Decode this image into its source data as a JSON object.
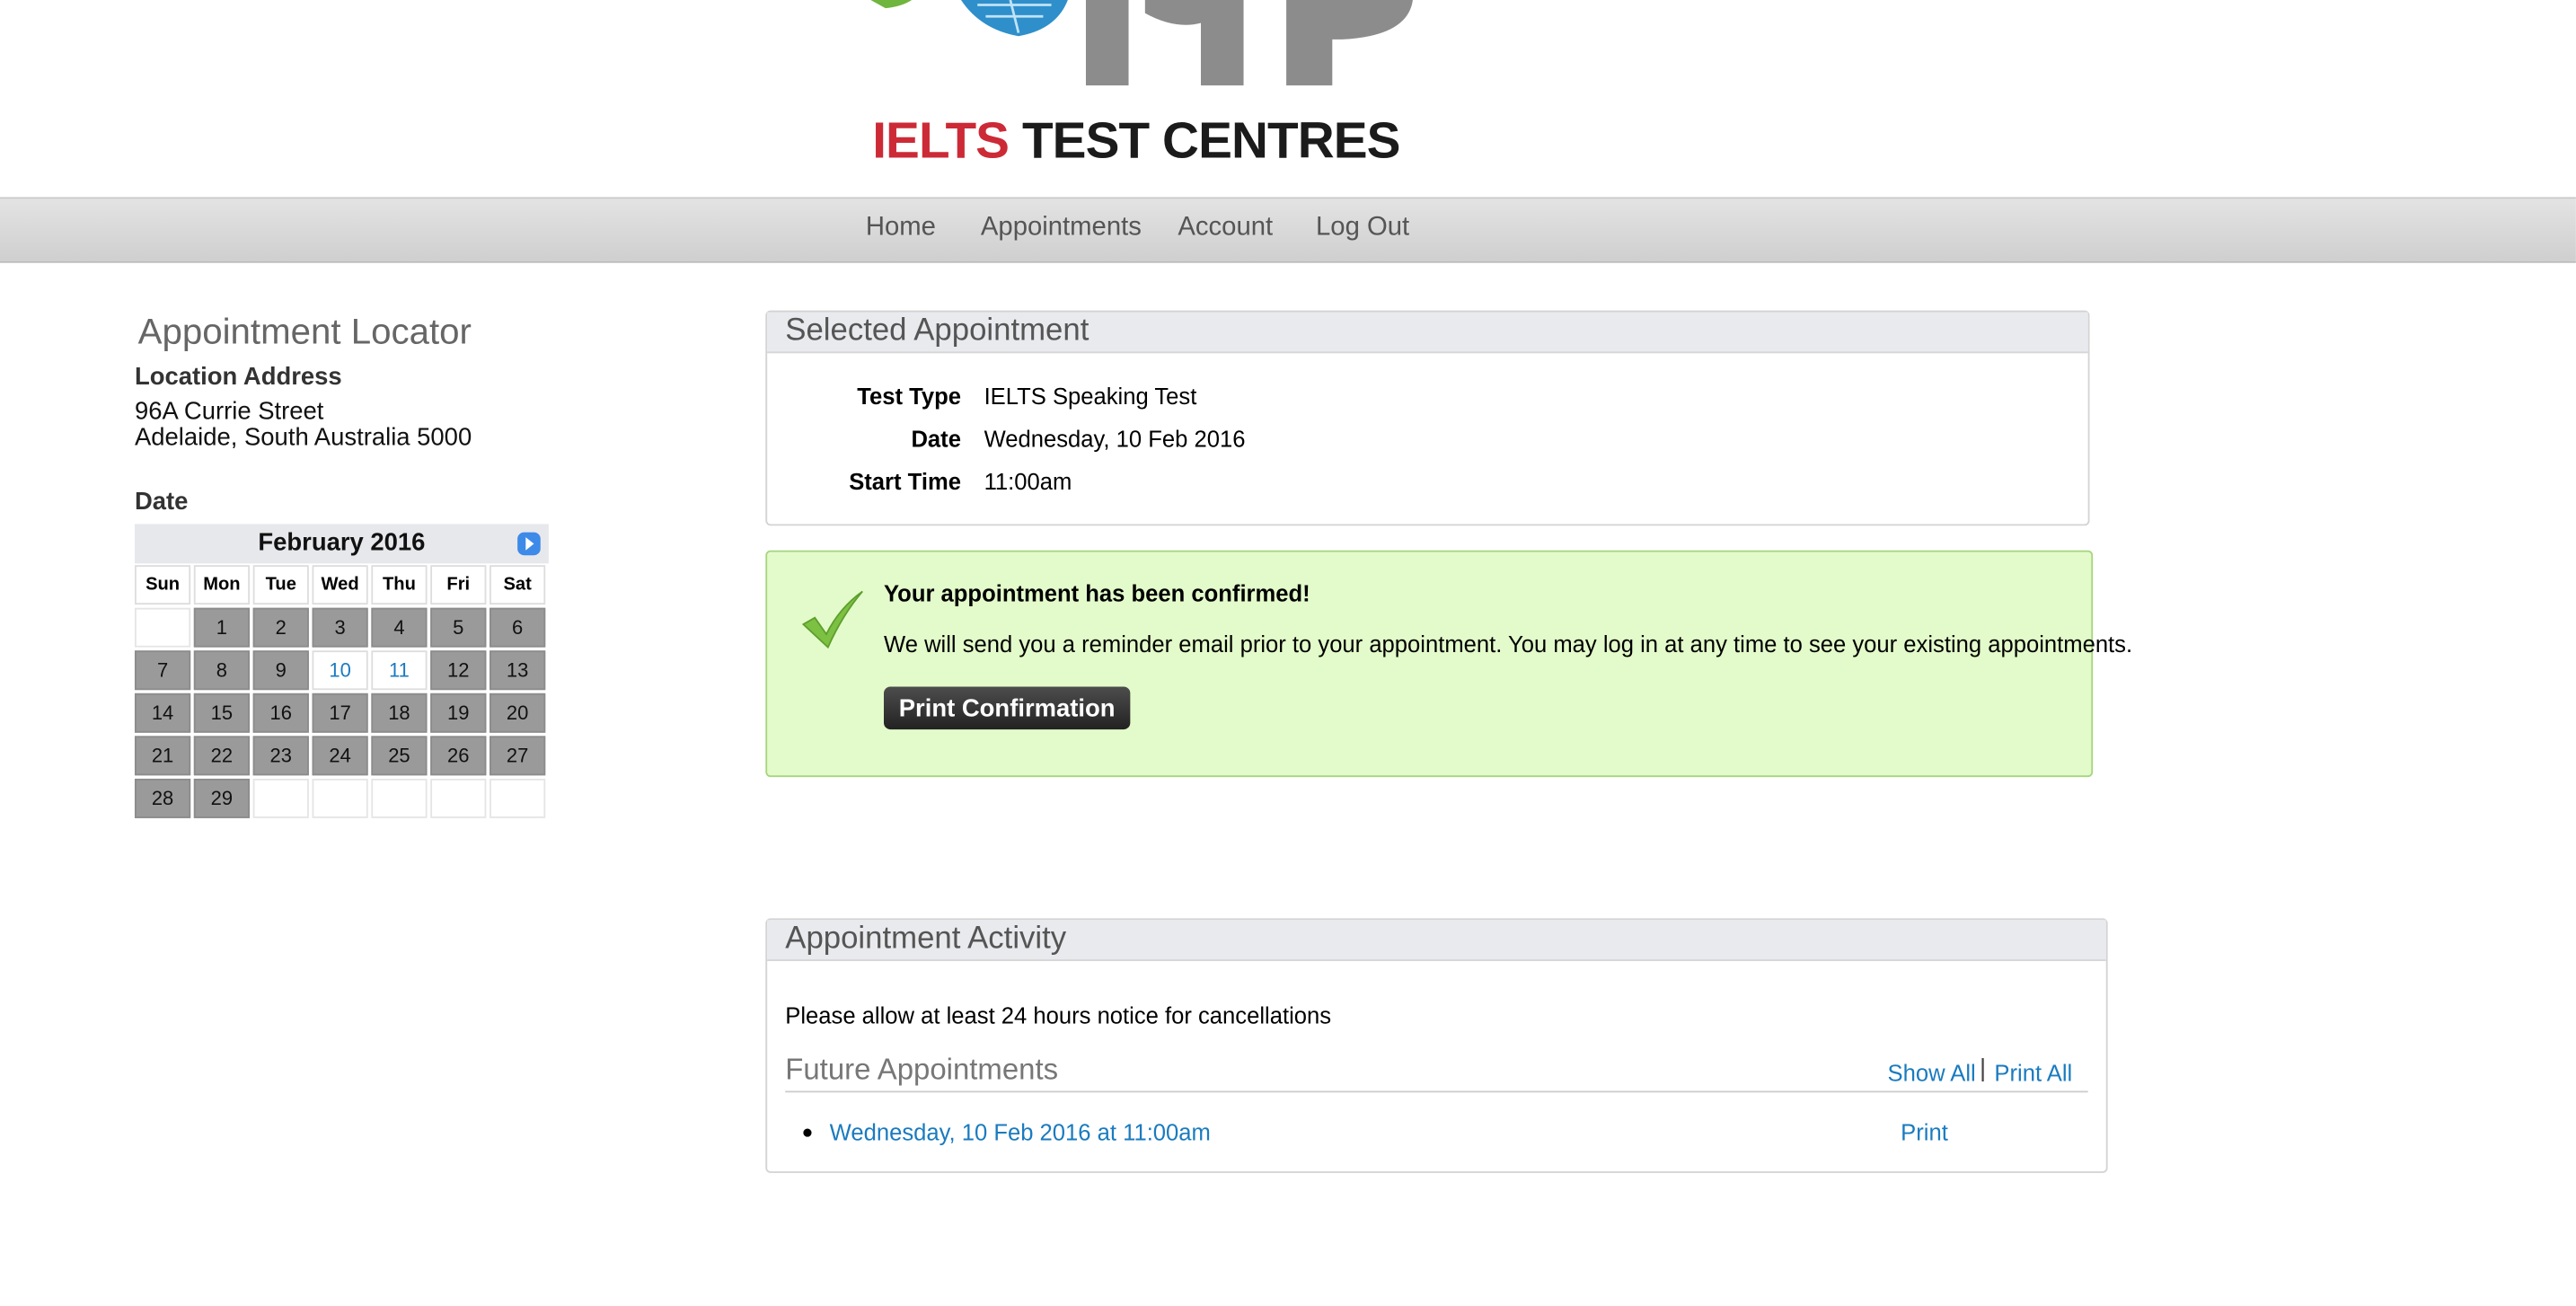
{
  "header": {
    "logo_brand": "idp",
    "logo_red": "IELTS",
    "logo_black": "TEST CENTRES"
  },
  "nav": [
    "Home",
    "Appointments",
    "Account",
    "Log Out"
  ],
  "locator": {
    "title": "Appointment Locator",
    "address_label": "Location Address",
    "address_line1": "96A Currie Street",
    "address_line2": "Adelaide, South Australia 5000",
    "date_label": "Date"
  },
  "calendar": {
    "month": "February 2016",
    "weekdays": [
      "Sun",
      "Mon",
      "Tue",
      "Wed",
      "Thu",
      "Fri",
      "Sat"
    ],
    "leading_blank_days": 1,
    "days_in_month": 29,
    "available_days": [
      10,
      11
    ]
  },
  "selected": {
    "title": "Selected Appointment",
    "rows": [
      {
        "label": "Test Type",
        "value": "IELTS Speaking Test"
      },
      {
        "label": "Date",
        "value": "Wednesday, 10 Feb 2016"
      },
      {
        "label": "Start Time",
        "value": "11:00am"
      }
    ]
  },
  "confirmation": {
    "title": "Your appointment has been confirmed!",
    "message": "We will send you a reminder email prior to your appointment. You may log in at any time to see your existing appointments.",
    "button": "Print Confirmation"
  },
  "activity": {
    "title": "Appointment Activity",
    "note": "Please allow at least 24 hours notice for cancellations",
    "future_title": "Future Appointments",
    "show_all": "Show All",
    "separator": "|",
    "print_all": "Print All",
    "appointments": [
      {
        "text": "Wednesday, 10 Feb 2016 at 11:00am",
        "action": "Print"
      }
    ]
  },
  "colors": {
    "link": "#1a7bbf",
    "confirm_bg": "#e3fbca",
    "logo_red": "#cc2a36"
  }
}
